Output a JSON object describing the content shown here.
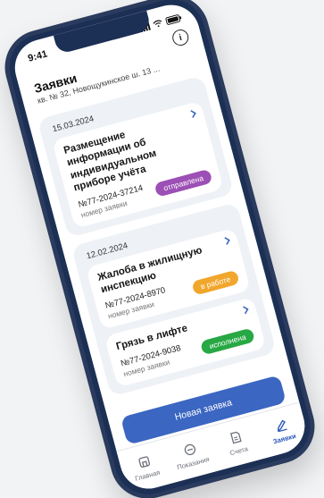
{
  "status_bar": {
    "time": "9:41"
  },
  "header": {
    "title": "Заявки",
    "address": "кв. № 32, Новощукинское ш. 13 ...",
    "info_glyph": "i"
  },
  "groups": [
    {
      "date": "15.03.2024",
      "cards": [
        {
          "title": "Размещение информации об индивидуальном приборе учёта",
          "number": "№77-2024-37214",
          "number_label": "номер заявки",
          "status": "отправлена",
          "status_color": "#9c4fb4"
        }
      ]
    },
    {
      "date": "12.02.2024",
      "cards": [
        {
          "title": "Жалоба в жилищную инспекцию",
          "number": "№77-2024-8970",
          "number_label": "номер заявки",
          "status": "в работе",
          "status_color": "#f1a62c"
        },
        {
          "title": "Грязь в лифте",
          "number": "№77-2024-9038",
          "number_label": "номер заявки",
          "status": "исполнена",
          "status_color": "#27a844"
        }
      ]
    }
  ],
  "cta": {
    "label": "Новая заявка"
  },
  "tabbar": {
    "items": [
      {
        "label": "Главная",
        "icon": "home-icon"
      },
      {
        "label": "Показания",
        "icon": "meter-icon"
      },
      {
        "label": "Счета",
        "icon": "bill-icon"
      },
      {
        "label": "Заявки",
        "icon": "pencil-icon",
        "active": true
      }
    ]
  },
  "colors": {
    "accent": "#3b66c1",
    "frame": "#1c2f54"
  }
}
